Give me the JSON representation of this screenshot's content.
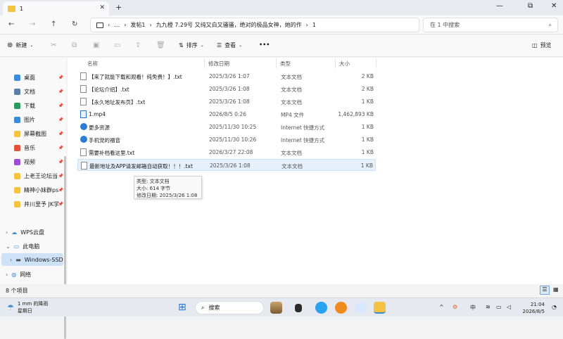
{
  "tab": {
    "title": "1",
    "close": "✕",
    "new": "+"
  },
  "window_controls": {
    "minimize": "—",
    "maximize": "⧉",
    "close": "✕"
  },
  "nav": {
    "back": "←",
    "forward": "→",
    "up": "↑",
    "refresh": "↻"
  },
  "address": {
    "more": "…",
    "crumbs": [
      "发帖1",
      "九九橙 7.29号 又纯又白又骚骚，绝对的极品女神，她的作",
      "1"
    ],
    "sep": "›"
  },
  "search": {
    "placeholder": "在 1 中搜索"
  },
  "toolbar": {
    "new": "新建",
    "sort": "排序",
    "view": "查看",
    "more": "•••",
    "details": "预览"
  },
  "sidebar": {
    "quick": [
      {
        "label": "桌面",
        "color": "#3b8bd9"
      },
      {
        "label": "文档",
        "color": "#5a7fa8"
      },
      {
        "label": "下载",
        "color": "#2c9a5e"
      },
      {
        "label": "图片",
        "color": "#3b8bd9"
      },
      {
        "label": "屏幕截图",
        "color": "#f5c342"
      },
      {
        "label": "音乐",
        "color": "#e0523a"
      },
      {
        "label": "视频",
        "color": "#9c4fd1"
      },
      {
        "label": "上老王论坛当",
        "color": "#f5c342"
      },
      {
        "label": "精神小妹群ps",
        "color": "#f5c342"
      },
      {
        "label": "井川里予 JK学",
        "color": "#f5c342"
      }
    ],
    "tree": [
      {
        "label": "WPS云盘",
        "chevron": "›"
      },
      {
        "label": "此电脑",
        "chevron": "⌄"
      },
      {
        "label": "Windows-SSD",
        "chevron": "›"
      },
      {
        "label": "网络",
        "chevron": "›"
      }
    ],
    "pin": "📌"
  },
  "columns": {
    "name": "名称",
    "date": "修改日期",
    "type": "类型",
    "size": "大小"
  },
  "files": [
    {
      "name": "【来了就能下载和观看！纯免费！】.txt",
      "date": "2025/3/26 1:07",
      "type": "文本文档",
      "size": "2 KB",
      "kind": "txt"
    },
    {
      "name": "【论坛介绍】.txt",
      "date": "2025/3/26 1:08",
      "type": "文本文档",
      "size": "2 KB",
      "kind": "txt"
    },
    {
      "name": "【永久地址发布页】.txt",
      "date": "2025/3/26 1:08",
      "type": "文本文档",
      "size": "1 KB",
      "kind": "txt"
    },
    {
      "name": "1.mp4",
      "date": "2026/8/5 0:26",
      "type": "MP4 文件",
      "size": "1,462,893 KB",
      "kind": "mp4"
    },
    {
      "name": "更多资源",
      "date": "2025/11/30 10:25",
      "type": "Internet 快捷方式",
      "size": "1 KB",
      "kind": "lnk"
    },
    {
      "name": "手机党的福音",
      "date": "2025/11/30 10:26",
      "type": "Internet 快捷方式",
      "size": "1 KB",
      "kind": "lnk"
    },
    {
      "name": "需要补档看这里.txt",
      "date": "2026/3/27 22:08",
      "type": "文本文档",
      "size": "1 KB",
      "kind": "txt"
    },
    {
      "name": "最新地址及APP请发邮箱自动获取！！！.txt",
      "date": "2025/3/26 1:08",
      "type": "文本文档",
      "size": "1 KB",
      "kind": "txt"
    }
  ],
  "tooltip": {
    "type": "类型: 文本文档",
    "size": "大小: 614 字节",
    "date": "修改日期: 2025/3/26 1:08"
  },
  "status": {
    "count": "8 个项目"
  },
  "taskbar": {
    "weather_temp": "1 mm 的降雨",
    "weather_day": "星期日",
    "search": "搜索",
    "tray": {
      "chevron": "^",
      "ime": "中",
      "clock_time": "21:04",
      "clock_date": "2026/8/5"
    }
  }
}
